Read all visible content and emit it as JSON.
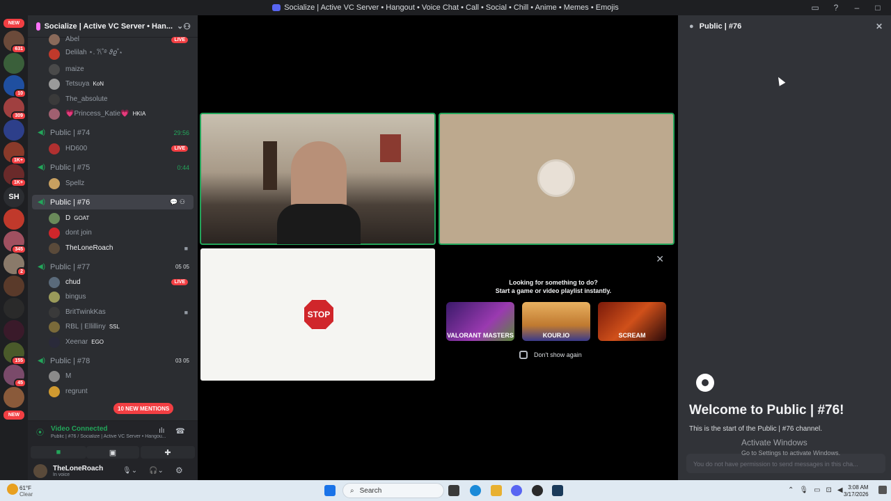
{
  "window": {
    "title": "Socialize | Active VC Server • Hangout • Voice Chat • Call • Social • Chill • Anime • Memes • Emojis"
  },
  "guilds": {
    "new_top": "NEW",
    "badges": [
      "631",
      "10",
      "309",
      "1K+",
      "1K+",
      "345",
      "2",
      "155",
      "45"
    ],
    "sh_label": "SH",
    "new_bottom": "NEW"
  },
  "server": {
    "name": "Socialize | Active VC Server • Han...",
    "live_label": "LIVE"
  },
  "channels": {
    "top_users": [
      {
        "name": "Abel",
        "badge": ""
      },
      {
        "name": "Delilah ⋆. 𐙚˚࿔ 𝜗𝜚˚⋆",
        "badge": ""
      },
      {
        "name": "maize",
        "badge": ""
      },
      {
        "name": "Tetsuya",
        "badge": "KoN"
      },
      {
        "name": "The_absolute",
        "badge": ""
      },
      {
        "name": "💗Princess_Katie💗",
        "badge": "HKIA"
      }
    ],
    "c74": {
      "name": "Public | #74",
      "time": "29:56",
      "users": [
        {
          "name": "HD600",
          "live": "LIVE"
        }
      ]
    },
    "c75": {
      "name": "Public | #75",
      "time": "0:44",
      "users": [
        {
          "name": "Spellz"
        }
      ]
    },
    "c76": {
      "name": "Public | #76",
      "users": [
        {
          "name": "D",
          "badge": "GOAT"
        },
        {
          "name": "dont join"
        },
        {
          "name": "TheLoneRoach"
        }
      ]
    },
    "c77": {
      "name": "Public | #77",
      "count_a": "05",
      "count_b": "05",
      "users": [
        {
          "name": "chud",
          "live": "LIVE"
        },
        {
          "name": "bingus"
        },
        {
          "name": "BritTwinkKas"
        },
        {
          "name": "RBL | Ellilliny",
          "badge": "SSL"
        },
        {
          "name": "Xeenar",
          "badge": "EGO"
        }
      ]
    },
    "c78": {
      "name": "Public | #78",
      "count_a": "03",
      "count_b": "05",
      "users": [
        {
          "name": "M"
        },
        {
          "name": "regrunt"
        }
      ]
    },
    "mentions": "10 NEW MENTIONS"
  },
  "voice": {
    "status": "Video Connected",
    "subtitle": "Public | #76 / Socialize | Active VC Server • Hangou..."
  },
  "user": {
    "name": "TheLoneRoach",
    "status": "In voice"
  },
  "stage": {
    "stop_text": "STOP",
    "activity_title_1": "Looking for something to do?",
    "activity_title_2": "Start a game or video playlist instantly.",
    "games": [
      "VALORANT MASTERS",
      "KOUR.IO",
      "SCREAM"
    ],
    "dont_show": "Don't show again"
  },
  "chat": {
    "channel": "Public | #76",
    "welcome": "Welcome to Public | #76!",
    "subtitle": "This is the start of the Public | #76 channel.",
    "activate_title": "Activate Windows",
    "activate_sub": "Go to Settings to activate Windows.",
    "input_placeholder": "You do not have permission to send messages in this cha..."
  },
  "taskbar": {
    "weather_temp": "61°F",
    "weather_desc": "Clear",
    "search": "Search",
    "time": "3:08 AM",
    "date": "3/17/2026"
  },
  "colors": {
    "accent_green": "#23a55a",
    "live_red": "#f23f43",
    "blurple": "#5865f2"
  }
}
